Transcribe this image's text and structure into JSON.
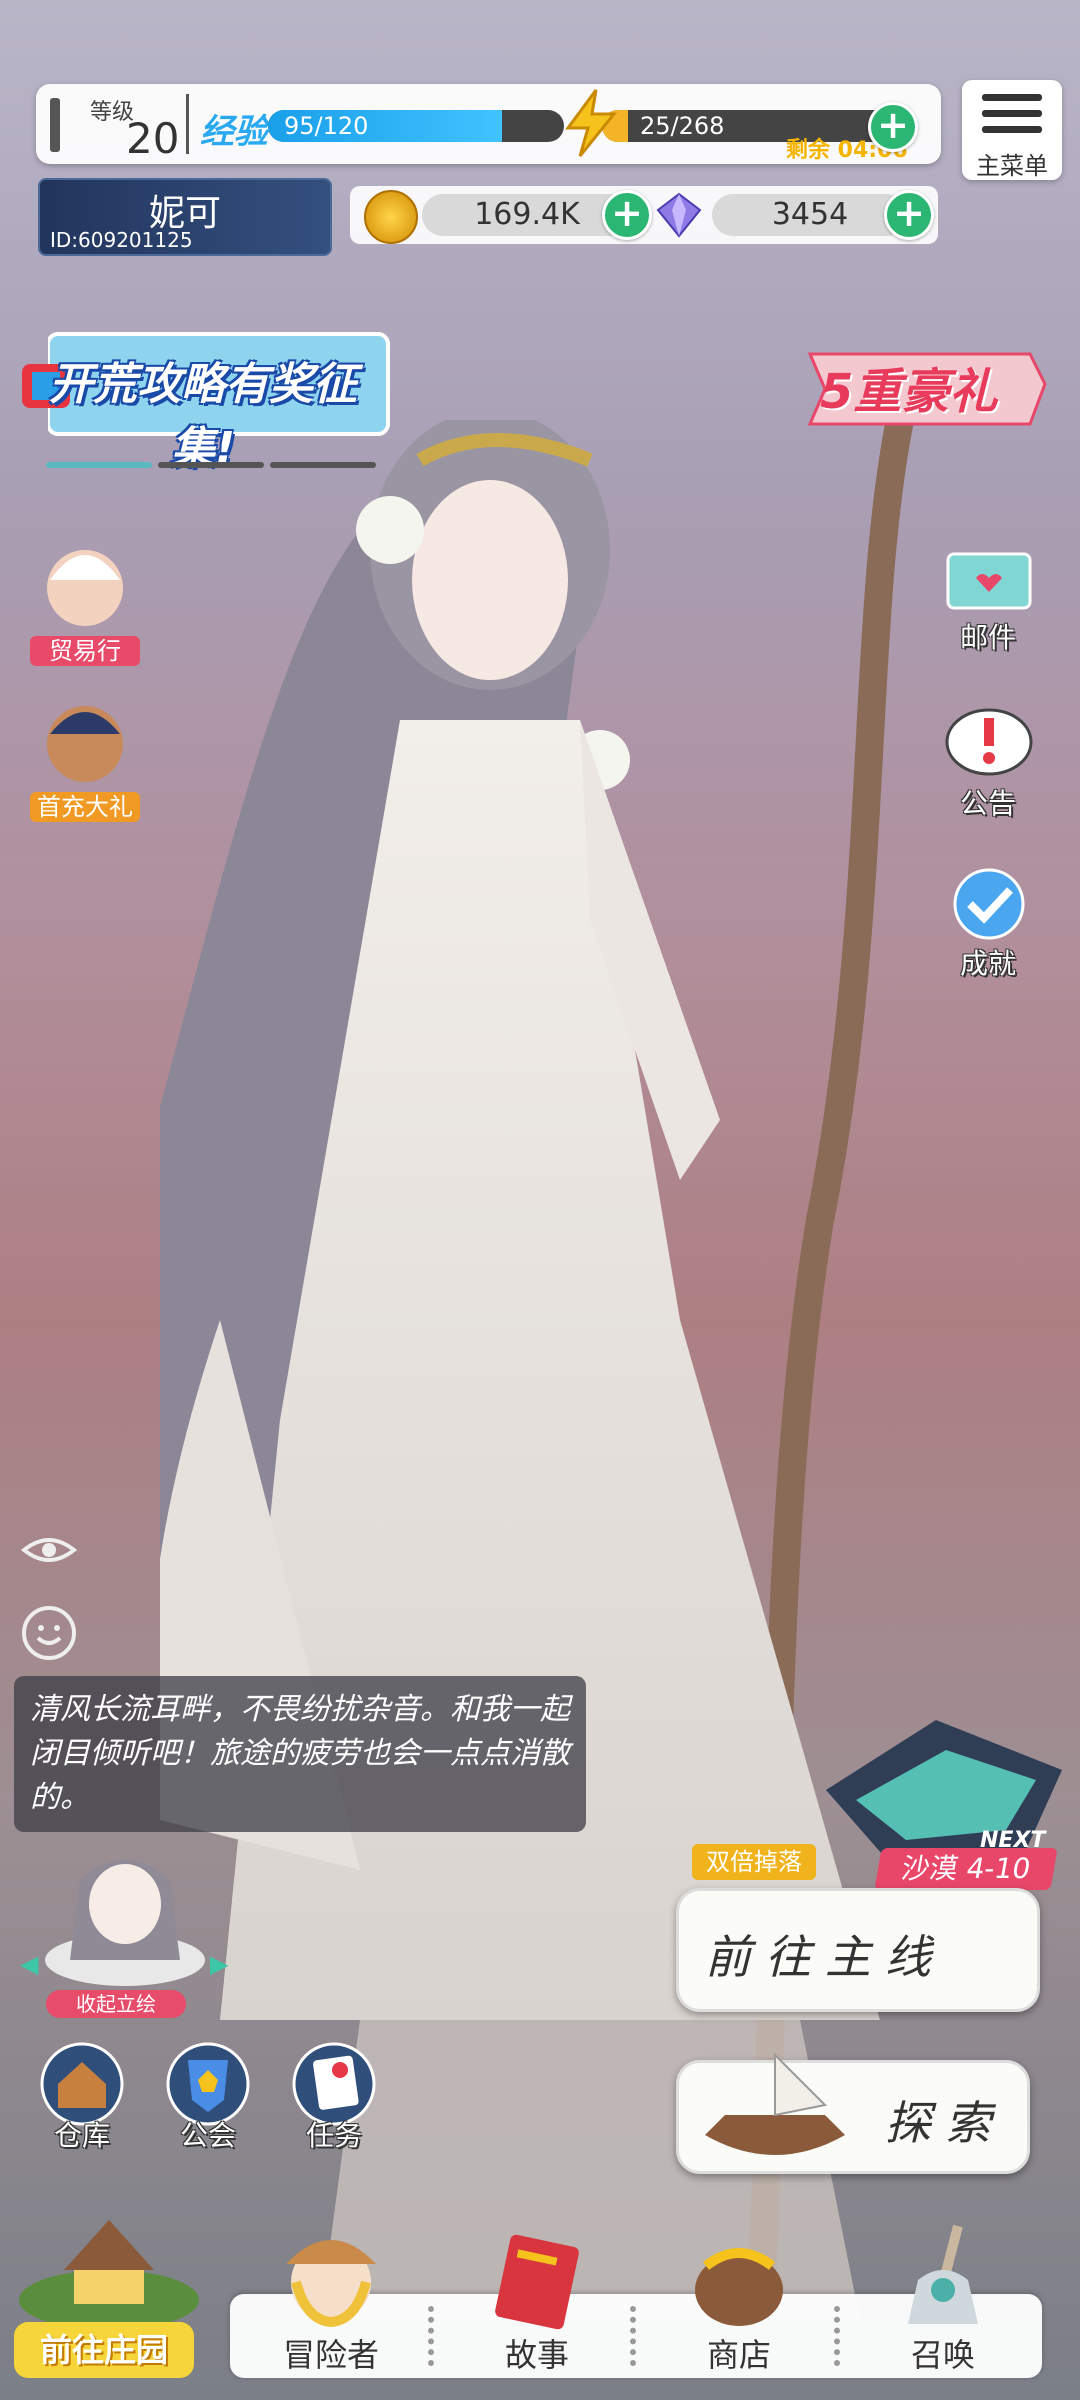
{
  "status": {
    "level_label": "等级",
    "level_value": "20",
    "exp_label": "经验",
    "exp_text": "95/120",
    "exp_progress": 0.79,
    "energy_text": "25/268",
    "energy_progress": 0.09,
    "energy_timer": "剩余 04:06"
  },
  "menu": {
    "label": "主菜单",
    "icon": "hamburger-icon"
  },
  "player": {
    "name": "妮可",
    "id": "ID:609201125"
  },
  "currency": {
    "coins": "169.4K",
    "gems": "3454"
  },
  "event_banner": {
    "text": "开荒攻略有奖征集!"
  },
  "gift_banner": {
    "text": "5重豪礼"
  },
  "left_side": [
    {
      "label": "贸易行",
      "icon": "merchant-icon"
    },
    {
      "label": "首充大礼",
      "icon": "first-recharge-icon"
    }
  ],
  "right_side": [
    {
      "label": "邮件",
      "icon": "mail-icon"
    },
    {
      "label": "公告",
      "icon": "notice-icon"
    },
    {
      "label": "成就",
      "icon": "achievement-icon"
    }
  ],
  "dialogue": {
    "text": "清风长流耳畔，不畏纷扰杂音。和我一起闭目倾听吧！旅途的疲劳也会一点点消散的。"
  },
  "portrait": {
    "label": "收起立绘"
  },
  "mini_actions": [
    {
      "label": "仓库",
      "icon": "warehouse-icon"
    },
    {
      "label": "公会",
      "icon": "guild-icon"
    },
    {
      "label": "任务",
      "icon": "quest-icon"
    }
  ],
  "stage": {
    "next": "NEXT",
    "name": "沙漠 4-10",
    "double_drop": "双倍掉落"
  },
  "main_buttons": {
    "mainline": "前往主线",
    "explore": "探索"
  },
  "bottom_nav": {
    "farm": "前往庄园",
    "items": [
      {
        "label": "冒险者",
        "icon": "adventurer-icon"
      },
      {
        "label": "故事",
        "icon": "story-book-icon"
      },
      {
        "label": "商店",
        "icon": "shop-bag-icon"
      },
      {
        "label": "召唤",
        "icon": "summon-icon"
      }
    ]
  },
  "colors": {
    "accent_green": "#2bb673",
    "exp_blue": "#1aa0ea",
    "energy_yellow": "#f3b428",
    "pink": "#e8476a"
  }
}
